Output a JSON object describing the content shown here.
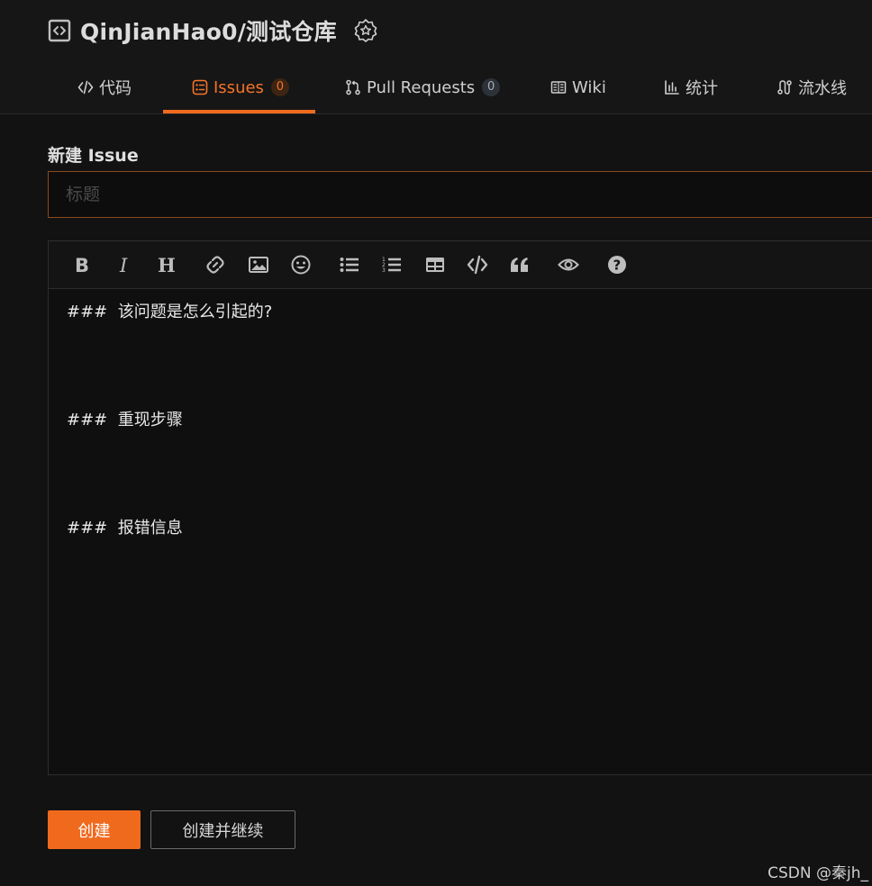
{
  "repo": {
    "name": "QinJianHao0/测试仓库",
    "icon": "repo-code-icon",
    "badge_icon": "award-badge-icon"
  },
  "tabs": [
    {
      "label": "代码",
      "icon": "code-icon"
    },
    {
      "label": "Issues",
      "icon": "issues-icon",
      "count": "0",
      "active": true
    },
    {
      "label": "Pull Requests",
      "icon": "pull-request-icon",
      "count": "0"
    },
    {
      "label": "Wiki",
      "icon": "book-icon"
    },
    {
      "label": "统计",
      "icon": "bar-chart-icon"
    },
    {
      "label": "流水线",
      "icon": "pipeline-icon"
    }
  ],
  "form": {
    "heading": "新建 Issue",
    "title_placeholder": "标题",
    "title_value": ""
  },
  "editor": {
    "toolbar": [
      "bold-icon",
      "italic-icon",
      "heading-icon",
      "link-icon",
      "image-icon",
      "emoji-icon",
      "unordered-list-icon",
      "ordered-list-icon",
      "table-icon",
      "code-icon",
      "quote-icon",
      "preview-eye-icon",
      "help-icon"
    ],
    "lines": [
      "###  该问题是怎么引起的?",
      "###  重现步骤",
      "###  报错信息"
    ]
  },
  "actions": {
    "create_label": "创建",
    "create_continue_label": "创建并继续"
  },
  "watermark": "CSDN @秦jh_",
  "colors": {
    "accent": "#f06a1e",
    "background": "#121212"
  }
}
